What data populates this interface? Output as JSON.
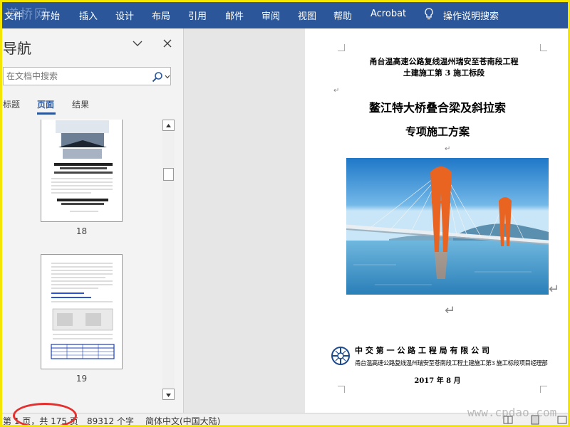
{
  "ribbon": {
    "watermark": "道桥网",
    "tabs": [
      "文件",
      "开始",
      "插入",
      "设计",
      "布局",
      "引用",
      "邮件",
      "审阅",
      "视图",
      "帮助",
      "Acrobat"
    ],
    "tell_me": "操作说明搜索",
    "background": "#2b579a"
  },
  "nav": {
    "title": "导航",
    "search_placeholder": "在文档中搜索",
    "tabs": [
      "标题",
      "页面",
      "结果"
    ],
    "active_tab": "页面",
    "pages": [
      "18",
      "19"
    ]
  },
  "document": {
    "header_line1": "甬台温高速公路复线温州瑞安至苍南段工程",
    "header_line2": "土建施工第 3 施工标段",
    "title_line1": "鳌江特大桥叠合梁及斜拉索",
    "title_line2": "专项施工方案",
    "company": "中 交 第 一 公 路 工 程 局 有 限 公 司",
    "department": "甬台温高速公路复线温州瑞安至苍南段工程土建施工第3 施工标段项目经理部",
    "date": "2017 年 8 月"
  },
  "status": {
    "page_info": "第 1 页，共 175 页",
    "word_count": "89312 个字",
    "language": "简体中文(中国大陆)",
    "site_watermark": "www.cpdao.com"
  },
  "colors": {
    "ring": "#e53030",
    "frame": "#f4e600"
  }
}
